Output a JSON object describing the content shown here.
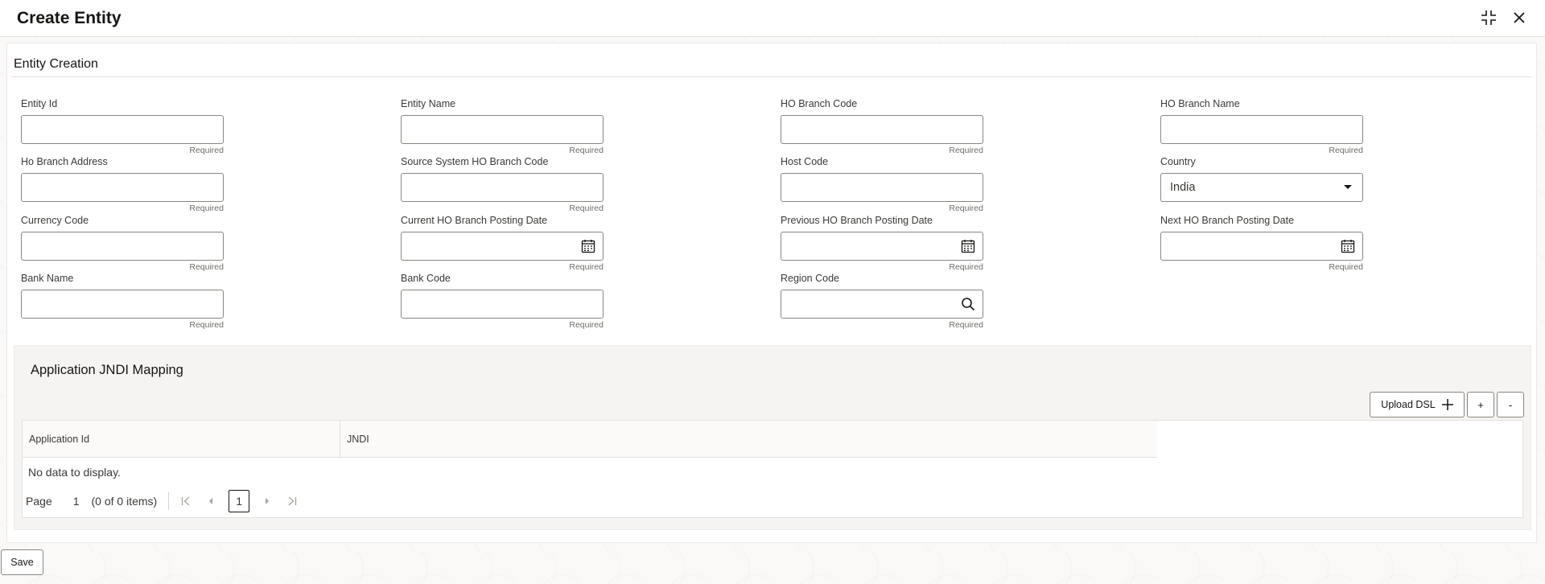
{
  "window": {
    "title": "Create Entity",
    "icons": [
      "collapse-icon",
      "close-icon"
    ]
  },
  "section": {
    "title": "Entity Creation"
  },
  "fields": {
    "entity_id": {
      "label": "Entity Id",
      "value": "",
      "hint": "Required"
    },
    "entity_name": {
      "label": "Entity Name",
      "value": "",
      "hint": "Required"
    },
    "ho_branch_code": {
      "label": "HO Branch Code",
      "value": "",
      "hint": "Required"
    },
    "ho_branch_name": {
      "label": "HO Branch Name",
      "value": "",
      "hint": "Required"
    },
    "ho_branch_address": {
      "label": "Ho Branch Address",
      "value": "",
      "hint": "Required"
    },
    "source_system_ho_branch_code": {
      "label": "Source System HO Branch Code",
      "value": "",
      "hint": "Required"
    },
    "host_code": {
      "label": "Host Code",
      "value": "",
      "hint": "Required"
    },
    "country": {
      "label": "Country",
      "value": "India",
      "icon": "caret-down-icon"
    },
    "currency_code": {
      "label": "Currency Code",
      "value": "",
      "hint": "Required"
    },
    "current_ho_branch_posting_date": {
      "label": "Current HO Branch Posting Date",
      "value": "",
      "hint": "Required",
      "icon": "calendar-icon"
    },
    "previous_ho_branch_posting_date": {
      "label": "Previous HO Branch Posting Date",
      "value": "",
      "hint": "Required",
      "icon": "calendar-icon"
    },
    "next_ho_branch_posting_date": {
      "label": "Next HO Branch Posting Date",
      "value": "",
      "hint": "Required",
      "icon": "calendar-icon"
    },
    "bank_name": {
      "label": "Bank Name",
      "value": "",
      "hint": "Required"
    },
    "bank_code": {
      "label": "Bank Code",
      "value": "",
      "hint": "Required"
    },
    "region_code": {
      "label": "Region Code",
      "value": "",
      "hint": "Required",
      "icon": "search-icon"
    }
  },
  "jndi": {
    "title": "Application JNDI Mapping",
    "buttons": {
      "upload_dsl": "Upload DSL",
      "add": "+",
      "remove": "-"
    },
    "table": {
      "columns": [
        "Application Id",
        "JNDI"
      ],
      "rows": [],
      "empty_text": "No data to display."
    },
    "pager": {
      "page_label": "Page",
      "page_value": "1",
      "count_text": "(0 of 0 items)",
      "current_page": "1"
    }
  },
  "footer": {
    "save_label": "Save"
  }
}
